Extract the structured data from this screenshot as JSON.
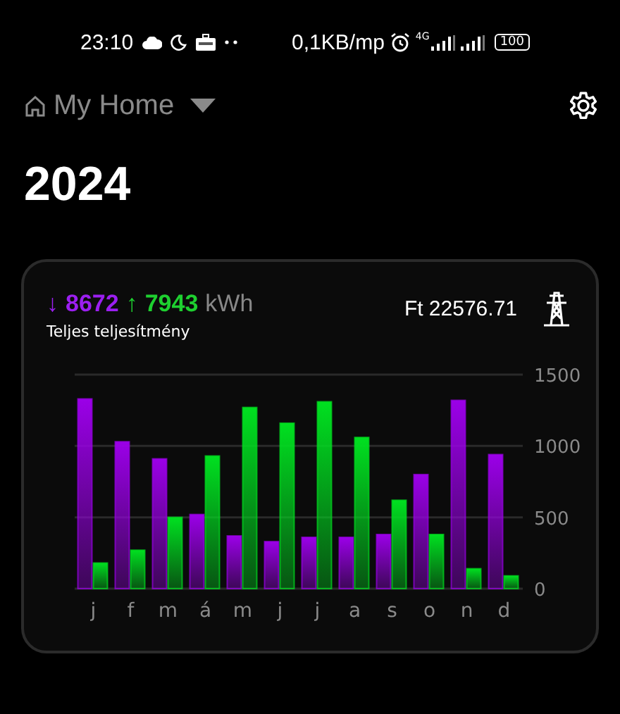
{
  "status_bar": {
    "time": "23:10",
    "speed": "0,1KB/mp",
    "network": "4G",
    "battery": "100"
  },
  "header": {
    "title": "My Home"
  },
  "year": "2024",
  "card": {
    "import_arrow": "↓",
    "import_value": "8672",
    "export_arrow": "↑",
    "export_value": "7943",
    "unit": "kWh",
    "subtitle": "Teljes teljesítmény",
    "cost": "Ft 22576.71",
    "chart_data": {
      "type": "bar",
      "categories": [
        "j",
        "f",
        "m",
        "á",
        "m",
        "j",
        "j",
        "a",
        "s",
        "o",
        "n",
        "d"
      ],
      "series": [
        {
          "color": "#9b00e8",
          "values": [
            1330,
            1030,
            910,
            520,
            370,
            330,
            360,
            360,
            380,
            800,
            1320,
            940
          ]
        },
        {
          "color": "#00e020",
          "values": [
            180,
            270,
            500,
            930,
            1270,
            1160,
            1310,
            1060,
            620,
            380,
            140,
            90
          ]
        }
      ],
      "ylim": [
        0,
        1500
      ],
      "yticks": [
        0,
        500,
        1000,
        1500
      ]
    }
  }
}
